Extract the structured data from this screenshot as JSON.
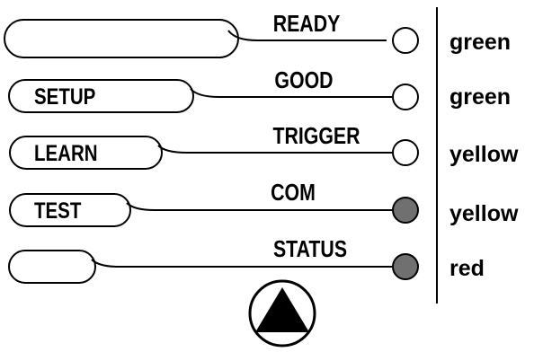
{
  "indicator_panel": {
    "rows": [
      {
        "button_label": "",
        "led_label": "READY",
        "led_color_name": "green",
        "led_lit": false
      },
      {
        "button_label": "SETUP",
        "led_label": "GOOD",
        "led_color_name": "green",
        "led_lit": false
      },
      {
        "button_label": "LEARN",
        "led_label": "TRIGGER",
        "led_color_name": "yellow",
        "led_lit": false
      },
      {
        "button_label": "TEST",
        "led_label": "COM",
        "led_color_name": "yellow",
        "led_lit": true
      },
      {
        "button_label": "",
        "led_label": "STATUS",
        "led_color_name": "red",
        "led_lit": true
      }
    ],
    "led_fill_lit": "#707070",
    "led_fill_unlit": "#ffffff",
    "up_arrow_icon": "triangle-up-in-circle"
  }
}
